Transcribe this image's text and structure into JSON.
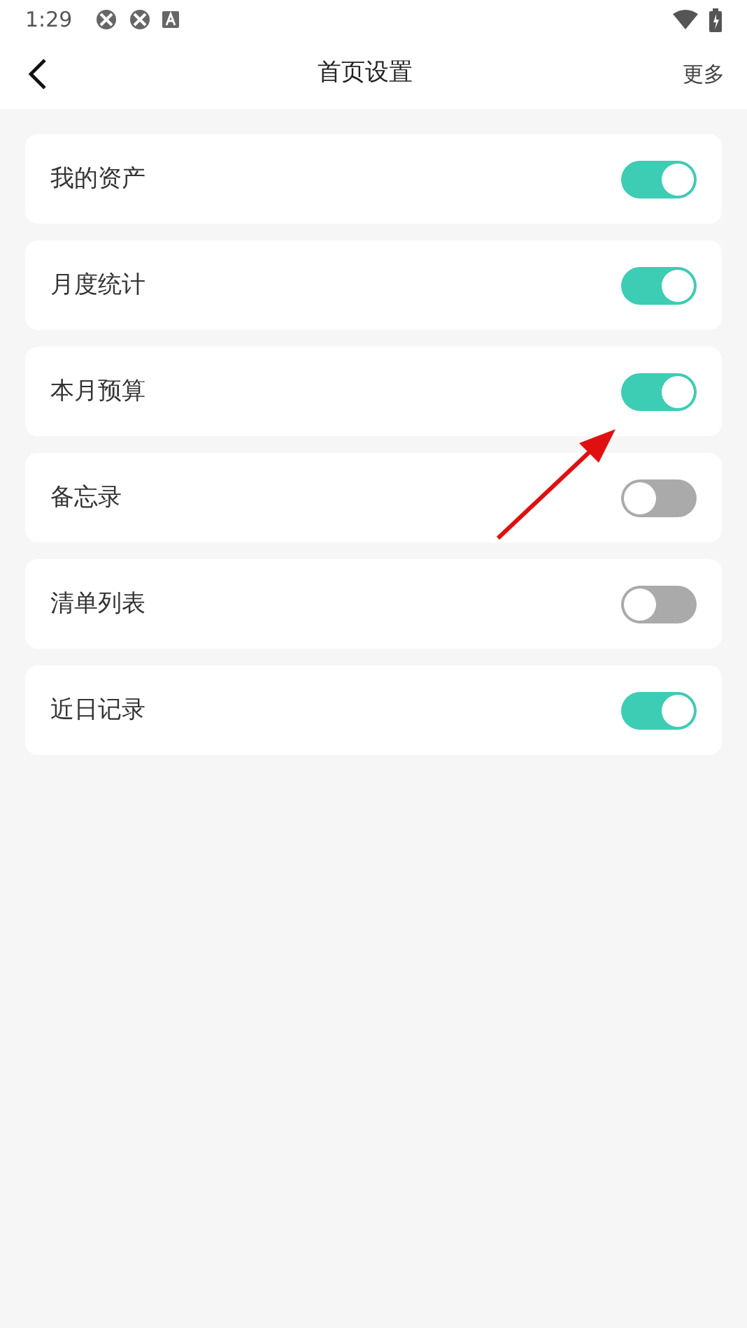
{
  "status_bar": {
    "time": "1:29"
  },
  "header": {
    "title": "首页设置",
    "action": "更多"
  },
  "settings": [
    {
      "label": "我的资产",
      "on": true
    },
    {
      "label": "月度统计",
      "on": true
    },
    {
      "label": "本月预算",
      "on": true
    },
    {
      "label": "备忘录",
      "on": false
    },
    {
      "label": "清单列表",
      "on": false
    },
    {
      "label": "近日记录",
      "on": true
    }
  ]
}
